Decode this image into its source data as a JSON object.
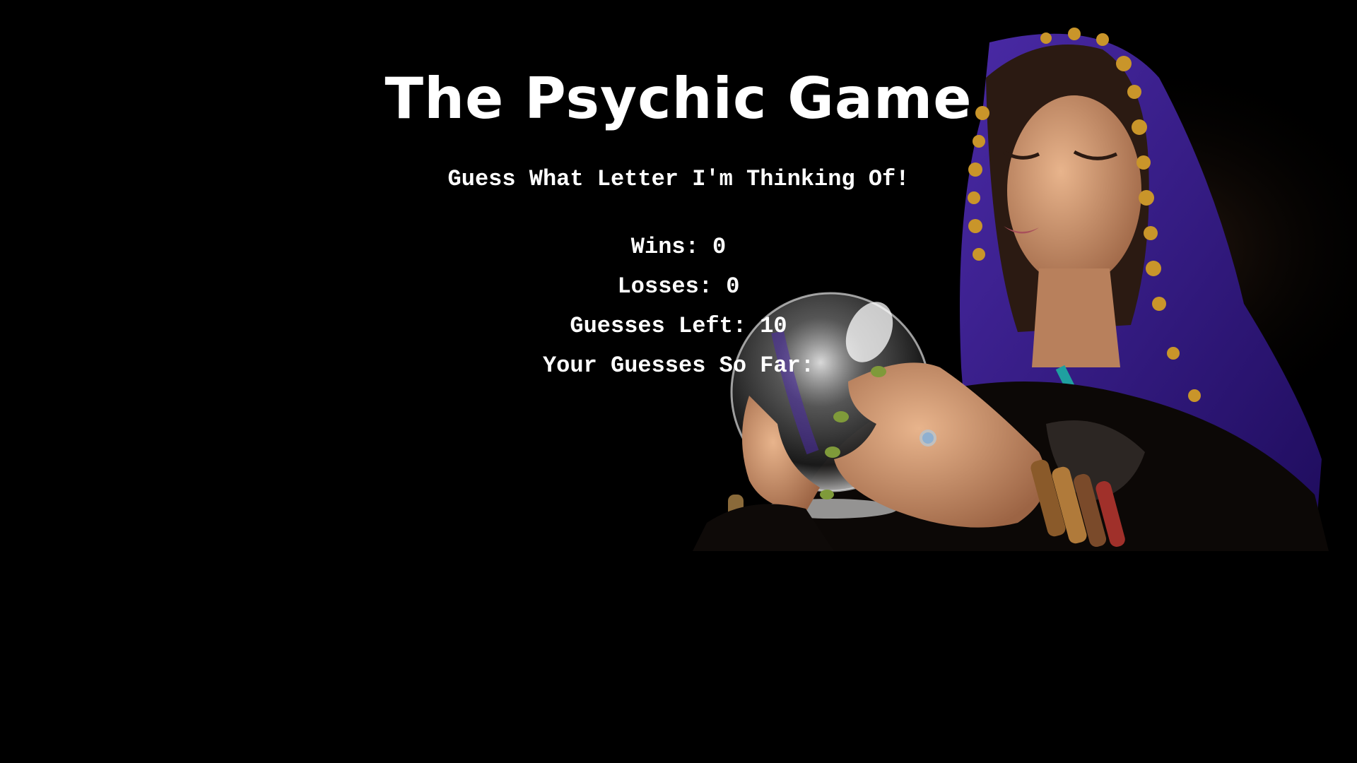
{
  "game": {
    "title": "The Psychic Game",
    "subtitle": "Guess What Letter I'm Thinking Of!",
    "stats": {
      "wins_label": "Wins:",
      "wins_value": "0",
      "losses_label": "Losses:",
      "losses_value": "0",
      "guesses_left_label": "Guesses Left:",
      "guesses_left_value": "10",
      "guesses_so_far_label": "Your Guesses So Far:",
      "guesses_so_far_value": ""
    }
  },
  "colors": {
    "background": "#000000",
    "text": "#ffffff",
    "scarf": "#3a1a8c",
    "gold": "#c9952a",
    "skin": "#d9a07a"
  },
  "icons": {
    "background_image": "fortune-teller-crystal-ball-image"
  }
}
